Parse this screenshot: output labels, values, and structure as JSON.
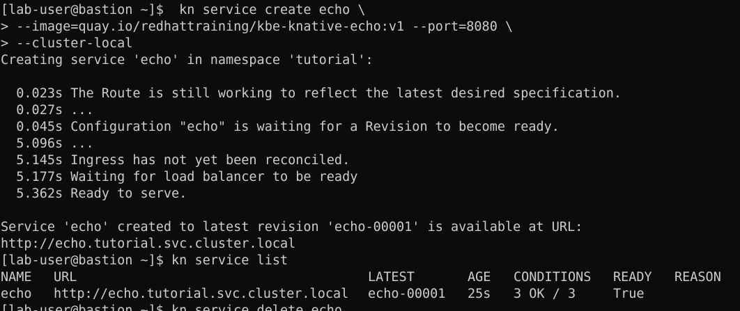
{
  "terminal": {
    "lines": [
      "[lab-user@bastion ~]$  kn service create echo \\",
      "> --image=quay.io/redhattraining/kbe-knative-echo:v1 --port=8080 \\",
      "> --cluster-local",
      "Creating service 'echo' in namespace 'tutorial':",
      "",
      "  0.023s The Route is still working to reflect the latest desired specification.",
      "  0.027s ...",
      "  0.045s Configuration \"echo\" is waiting for a Revision to become ready.",
      "  5.096s ...",
      "  5.145s Ingress has not yet been reconciled.",
      "  5.177s Waiting for load balancer to be ready",
      "  5.362s Ready to serve.",
      "",
      "Service 'echo' created to latest revision 'echo-00001' is available at URL:",
      "http://echo.tutorial.svc.cluster.local",
      "[lab-user@bastion ~]$ kn service list"
    ],
    "table": {
      "headers": [
        "NAME",
        "URL",
        "LATEST",
        "AGE",
        "CONDITIONS",
        "READY",
        "REASON"
      ],
      "row": [
        "echo",
        "http://echo.tutorial.svc.cluster.local",
        "echo-00001",
        "25s",
        "3 OK / 3",
        "True",
        ""
      ]
    },
    "last_line": "[lab-user@bastion ~]$ kn service delete echo",
    "colors": {
      "background": "#0c0c0c",
      "foreground": "#cccccc"
    }
  }
}
